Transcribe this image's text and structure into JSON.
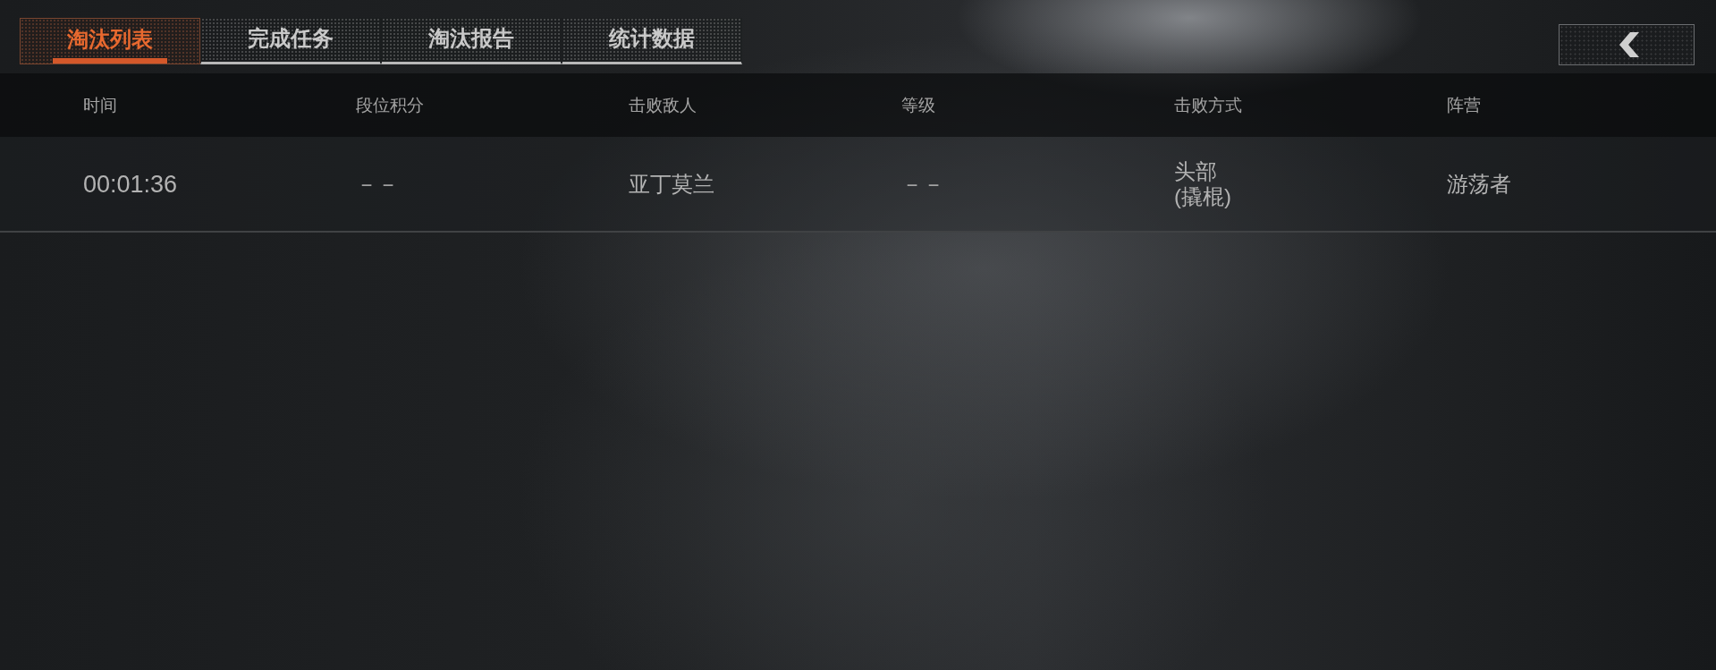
{
  "tabs": [
    {
      "label": "淘汰列表",
      "selected": true
    },
    {
      "label": "完成任务",
      "selected": false
    },
    {
      "label": "淘汰报告",
      "selected": false
    },
    {
      "label": "统计数据",
      "selected": false
    }
  ],
  "table": {
    "columns": [
      "时间",
      "段位积分",
      "击败敌人",
      "等级",
      "击败方式",
      "阵营"
    ],
    "rows": [
      [
        "00:01:36",
        "－－",
        "亚丁莫兰",
        "－－",
        "头部\n(撬棍)",
        "游荡者"
      ]
    ]
  }
}
